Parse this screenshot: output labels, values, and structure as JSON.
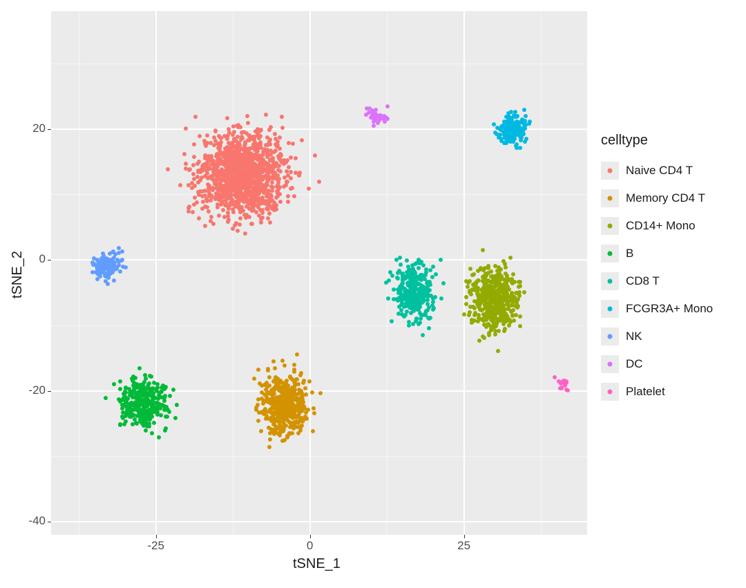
{
  "chart_data": {
    "type": "scatter",
    "title": "",
    "xlabel": "tSNE_1",
    "ylabel": "tSNE_2",
    "xlim": [
      -42,
      45
    ],
    "ylim": [
      -42,
      38
    ],
    "x_ticks": [
      -25,
      0,
      25
    ],
    "y_ticks": [
      -40,
      -20,
      0,
      20
    ],
    "legend_title": "celltype",
    "legend_position": "right",
    "grid": true,
    "panel_bg": "#ebebeb",
    "series": [
      {
        "name": "Naive CD4 T",
        "color": "#F8766D",
        "n": 1200,
        "cx": -11,
        "cy": 13,
        "sx": 15,
        "sy": 13
      },
      {
        "name": "Memory CD4 T",
        "color": "#D39200",
        "n": 430,
        "cx": -4,
        "cy": -22,
        "sx": 8,
        "sy": 10
      },
      {
        "name": "CD14+ Mono",
        "color": "#93AA00",
        "n": 480,
        "cx": 30,
        "cy": -6,
        "sx": 8,
        "sy": 10
      },
      {
        "name": "B",
        "color": "#00BA38",
        "n": 330,
        "cx": -27,
        "cy": -22,
        "sx": 8,
        "sy": 8
      },
      {
        "name": "CD8 T",
        "color": "#00C19F",
        "n": 300,
        "cx": 17,
        "cy": -5,
        "sx": 7,
        "sy": 9
      },
      {
        "name": "FCGR3A+ Mono",
        "color": "#00B9E3",
        "n": 150,
        "cx": 33,
        "cy": 20,
        "sx": 5,
        "sy": 5
      },
      {
        "name": "NK",
        "color": "#619CFF",
        "n": 140,
        "cx": -33,
        "cy": -1,
        "sx": 5,
        "sy": 4
      },
      {
        "name": "DC",
        "color": "#DB72FB",
        "n": 40,
        "cx": 11,
        "cy": 22,
        "sx": 4,
        "sy": 3
      },
      {
        "name": "Platelet",
        "color": "#FF61C3",
        "n": 18,
        "cx": 41,
        "cy": -19,
        "sx": 2,
        "sy": 2
      }
    ]
  }
}
